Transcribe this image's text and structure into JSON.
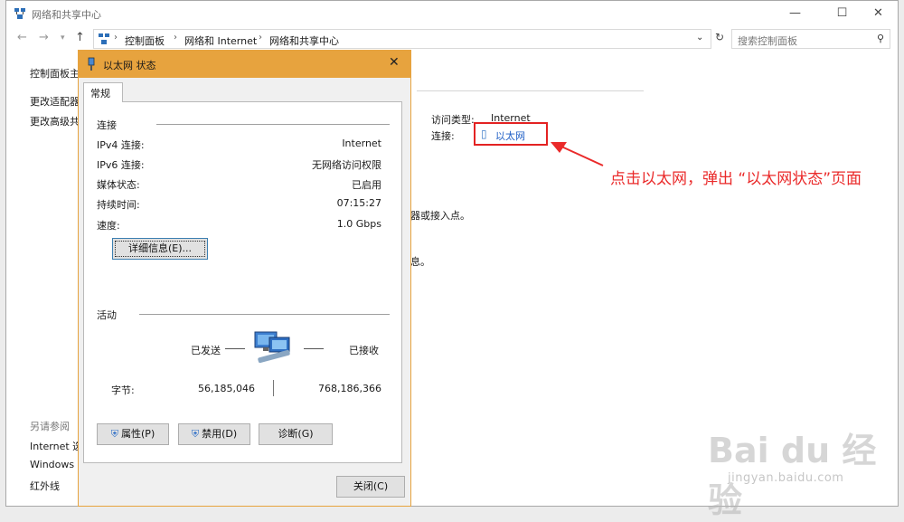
{
  "window": {
    "title": "网络和共享中心",
    "controls": {
      "minimize": "—",
      "maximize": "☐",
      "close": "✕"
    }
  },
  "address": {
    "crumbs": [
      "控制面板",
      "网络和 Internet",
      "网络和共享中心"
    ],
    "search_placeholder": "搜索控制面板"
  },
  "sidebar": {
    "home": "控制面板主",
    "items": [
      "更改适配器",
      "更改高级共"
    ],
    "see_also": "另请参阅",
    "see_also_items": [
      "Internet 选",
      "Windows D",
      "红外线"
    ]
  },
  "right_pane": {
    "access_type_label": "访问类型:",
    "access_type_value": "Internet",
    "connection_label": "连接:",
    "connection_link": "以太网",
    "text_fragment_1": "器或接入点。",
    "text_fragment_2": "息。"
  },
  "annotation": "点击以太网，弹出 “以太网状态”页面",
  "watermark": {
    "logo": "Bai du 经验",
    "url": "jingyan.baidu.com"
  },
  "dialog": {
    "title": "以太网 状态",
    "tab": "常规",
    "connection_group": "连接",
    "rows": [
      {
        "label": "IPv4 连接:",
        "value": "Internet"
      },
      {
        "label": "IPv6 连接:",
        "value": "无网络访问权限"
      },
      {
        "label": "媒体状态:",
        "value": "已启用"
      },
      {
        "label": "持续时间:",
        "value": "07:15:27"
      },
      {
        "label": "速度:",
        "value": "1.0 Gbps"
      }
    ],
    "details_button": "详细信息(E)...",
    "activity_group": "活动",
    "sent_label": "已发送",
    "received_label": "已接收",
    "bytes_label": "字节:",
    "bytes_sent": "56,185,046",
    "bytes_received": "768,186,366",
    "buttons": {
      "properties": "属性(P)",
      "disable": "禁用(D)",
      "diagnose": "诊断(G)",
      "close": "关闭(C)"
    }
  }
}
